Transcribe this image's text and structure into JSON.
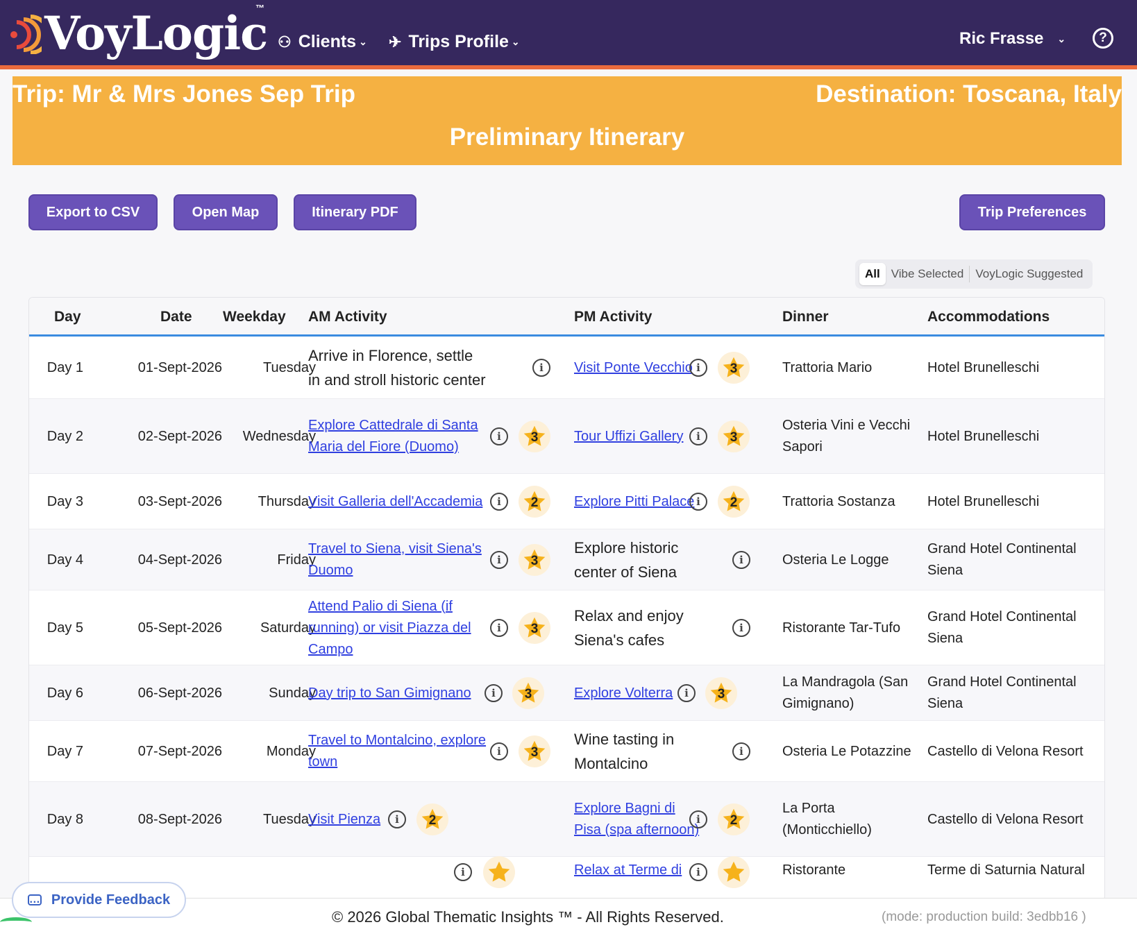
{
  "app": {
    "logo_text": "VoyLogic",
    "trademark": "™"
  },
  "nav": {
    "clients": "Clients",
    "trips_profile": "Trips Profile",
    "user_name": "Ric Frasse",
    "help_glyph": "?"
  },
  "banner": {
    "trip": "Trip: Mr & Mrs Jones Sep Trip",
    "destination": "Destination: Toscana, Italy",
    "title": "Preliminary Itinerary"
  },
  "buttons": {
    "export_csv": "Export to CSV",
    "open_map": "Open Map",
    "itinerary_pdf": "Itinerary PDF",
    "trip_preferences": "Trip Preferences"
  },
  "filter": {
    "all": "All",
    "vibe": "Vibe Selected",
    "suggested": "VoyLogic Suggested",
    "selected": "All"
  },
  "table": {
    "headers": {
      "day": "Day",
      "date": "Date",
      "weekday": "Weekday",
      "am": "AM Activity",
      "pm": "PM Activity",
      "dinner": "Dinner",
      "acc": "Accommodations"
    },
    "rows": [
      {
        "day": "Day 1",
        "date": "01-Sept-2026",
        "weekday": "Tuesday",
        "am": "Arrive in Florence, settle in and stroll historic center",
        "am_link": false,
        "am_rating": "",
        "pm": "Visit Ponte Vecchio",
        "pm_link": true,
        "pm_rating": "3",
        "dinner": "Trattoria Mario",
        "acc": "Hotel Brunelleschi"
      },
      {
        "day": "Day 2",
        "date": "02-Sept-2026",
        "weekday": "Wednesday",
        "am": "Explore Cattedrale di Santa Maria del Fiore (Duomo)",
        "am_link": true,
        "am_rating": "3",
        "pm": "Tour Uffizi Gallery",
        "pm_link": true,
        "pm_rating": "3",
        "dinner": "Osteria Vini e Vecchi Sapori",
        "acc": "Hotel Brunelleschi"
      },
      {
        "day": "Day 3",
        "date": "03-Sept-2026",
        "weekday": "Thursday",
        "am": "Visit Galleria dell'Accademia",
        "am_link": true,
        "am_rating": "2",
        "pm": "Explore Pitti Palace",
        "pm_link": true,
        "pm_rating": "2",
        "dinner": "Trattoria Sostanza",
        "acc": "Hotel Brunelleschi"
      },
      {
        "day": "Day 4",
        "date": "04-Sept-2026",
        "weekday": "Friday",
        "am": "Travel to Siena, visit Siena's Duomo",
        "am_link": true,
        "am_rating": "3",
        "pm": "Explore historic center of Siena",
        "pm_link": false,
        "pm_rating": "",
        "dinner": "Osteria Le Logge",
        "acc": "Grand Hotel Continental Siena"
      },
      {
        "day": "Day 5",
        "date": "05-Sept-2026",
        "weekday": "Saturday",
        "am": "Attend Palio di Siena (if running) or visit Piazza del Campo",
        "am_link": true,
        "am_rating": "3",
        "pm": "Relax and enjoy Siena's cafes",
        "pm_link": false,
        "pm_rating": "",
        "dinner": "Ristorante Tar-Tufo",
        "acc": "Grand Hotel Continental Siena"
      },
      {
        "day": "Day 6",
        "date": "06-Sept-2026",
        "weekday": "Sunday",
        "am": "Day trip to San Gimignano",
        "am_link": true,
        "am_rating": "3",
        "pm": "Explore Volterra",
        "pm_link": true,
        "pm_rating": "3",
        "dinner": "La Mandragola (San Gimignano)",
        "acc": "Grand Hotel Continental Siena"
      },
      {
        "day": "Day 7",
        "date": "07-Sept-2026",
        "weekday": "Monday",
        "am": "Travel to Montalcino, explore town",
        "am_link": true,
        "am_rating": "3",
        "pm": "Wine tasting in Montalcino",
        "pm_link": false,
        "pm_rating": "",
        "dinner": "Osteria Le Potazzine",
        "acc": "Castello di Velona Resort"
      },
      {
        "day": "Day 8",
        "date": "08-Sept-2026",
        "weekday": "Tuesday",
        "am": "Visit Pienza",
        "am_link": true,
        "am_rating": "2",
        "pm": "Explore Bagni di Pisa (spa afternoon)",
        "pm_link": true,
        "pm_rating": "2",
        "dinner": "La Porta (Monticchiello)",
        "acc": "Castello di Velona Resort"
      },
      {
        "day": "",
        "date": "",
        "weekday": "",
        "am": "",
        "am_link": true,
        "am_rating": "",
        "pm": "Relax at Terme di",
        "pm_link": true,
        "pm_rating": "",
        "dinner": "Ristorante",
        "acc": "Terme di Saturnia Natural"
      }
    ]
  },
  "footer": {
    "feedback": "Provide Feedback",
    "copyright": "© 2026 Global Thematic Insights ™ - All Rights Reserved.",
    "build": "(mode: production    build: 3edbb16 )"
  },
  "colors": {
    "header_bg": "#36285e",
    "accent_orange": "#ea6b3d",
    "banner": "#f5b142",
    "button": "#6a52b8",
    "link": "#2f3fe0"
  },
  "icons": {
    "clients": "people-icon",
    "trips": "plane-icon",
    "info": "info-icon",
    "rating": "star-icon",
    "feedback": "chat-icon",
    "help": "question-circle-icon"
  }
}
